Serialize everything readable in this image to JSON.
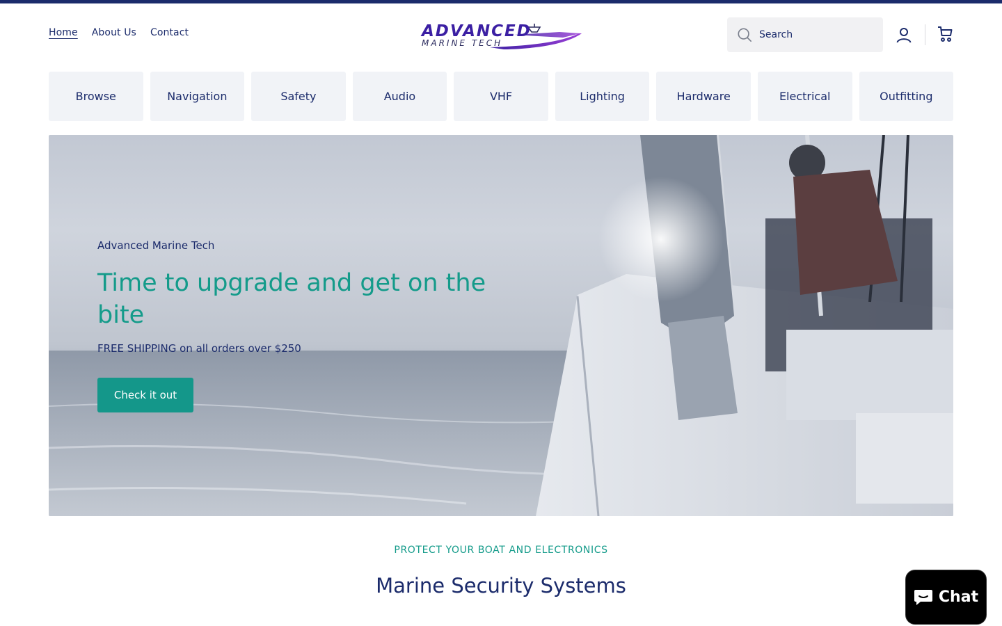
{
  "header": {
    "nav": [
      {
        "label": "Home",
        "active": true
      },
      {
        "label": "About Us",
        "active": false
      },
      {
        "label": "Contact",
        "active": false
      }
    ],
    "logo": {
      "line1": "ADVANCED",
      "line2": "MARINE TECH"
    },
    "search": {
      "placeholder": "Search",
      "icon": "search-icon"
    },
    "icons": {
      "account": "account-icon",
      "cart": "cart-icon"
    }
  },
  "categories": [
    "Browse",
    "Navigation",
    "Safety",
    "Audio",
    "VHF",
    "Lighting",
    "Hardware",
    "Electrical",
    "Outfitting"
  ],
  "hero": {
    "eyebrow": "Advanced Marine Tech",
    "headline": "Time to upgrade and get on the bite",
    "subtext": "FREE SHIPPING on all orders over $250",
    "cta": "Check it out"
  },
  "section": {
    "eyebrow": "PROTECT YOUR BOAT AND ELECTRONICS",
    "title": "Marine Security Systems"
  },
  "chat": {
    "label": "Chat",
    "icon": "chat-bubble-icon"
  },
  "colors": {
    "brand_navy": "#1b2b6b",
    "accent_teal": "#14978a",
    "logo_purple": "#3b1fa3",
    "category_bg": "#f1f3f7"
  }
}
